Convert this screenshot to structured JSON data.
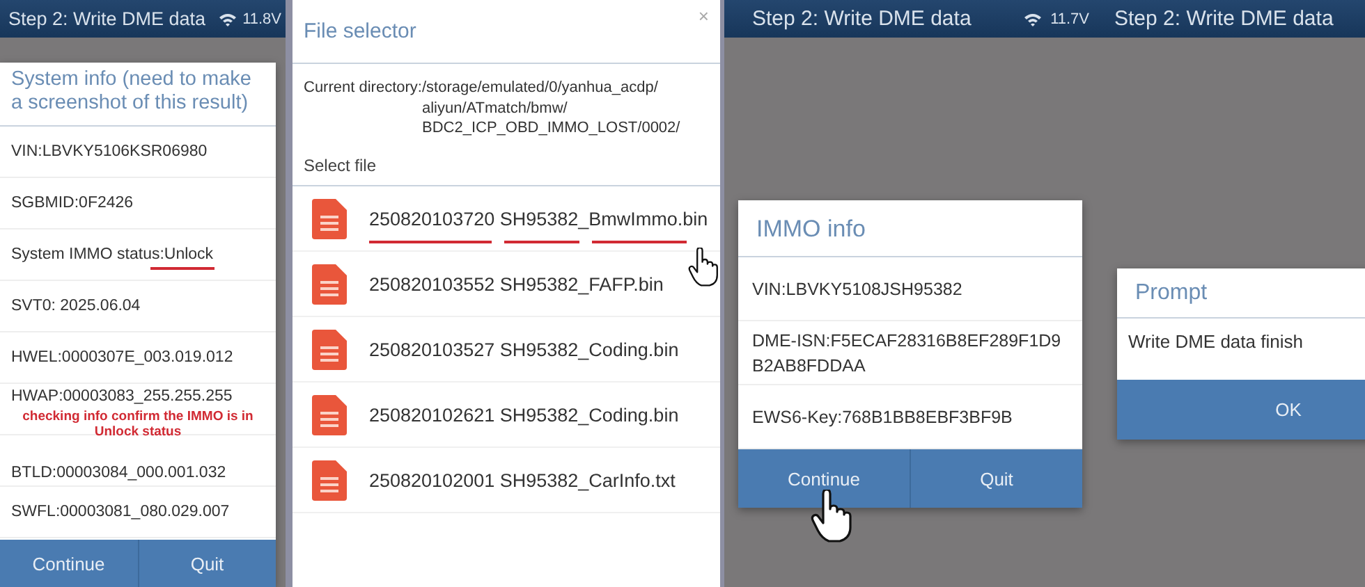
{
  "panels": [
    {
      "kind": "system_info",
      "header": {
        "title": "Step 2: Write DME data",
        "voltage": "11.8V"
      },
      "dialog": {
        "title": "System info (need to make a screenshot of this result)",
        "rows": [
          {
            "text": "VIN:LBVKY5106KSR06980",
            "underlined": false
          },
          {
            "text": "SGBMID:0F2426",
            "underlined": false
          },
          {
            "text": "System IMMO status:Unlock",
            "underlined": true
          },
          {
            "text": "SVT0: 2025.06.04",
            "underlined": false
          },
          {
            "text": "HWEL:0000307E_003.019.012",
            "underlined": false
          },
          {
            "text": "HWAP:00003083_255.255.255",
            "underlined": false,
            "note": "checking info confirm the IMMO is in Unlock status"
          },
          {
            "text": "BTLD:00003084_000.001.032",
            "underlined": false
          },
          {
            "text": "SWFL:00003081_080.029.007",
            "underlined": false
          }
        ],
        "buttons": [
          "Continue",
          "Quit"
        ]
      }
    },
    {
      "kind": "file_selector",
      "dialog": {
        "title": "File selector",
        "close": "×",
        "directory_label": "Current directory:",
        "directory_lines": [
          "/storage/emulated/0/yanhua_acdp/",
          "aliyun/ATmatch/bmw/",
          "BDC2_ICP_OBD_IMMO_LOST/0002/"
        ],
        "section": "Select file",
        "files": [
          {
            "name": "250820103720 SH95382_BmwImmo.bin",
            "underlined": true
          },
          {
            "name": "250820103552 SH95382_FAFP.bin",
            "underlined": false
          },
          {
            "name": "250820103527 SH95382_Coding.bin",
            "underlined": false
          },
          {
            "name": "250820102621 SH95382_Coding.bin",
            "underlined": false
          },
          {
            "name": "250820102001 SH95382_CarInfo.txt",
            "underlined": false
          }
        ]
      }
    },
    {
      "kind": "immo_info",
      "header": {
        "title": "Step 2: Write DME data",
        "voltage": "11.7V"
      },
      "dialog": {
        "title": "IMMO info",
        "rows": [
          {
            "text": "VIN:LBVKY5108JSH95382"
          },
          {
            "text": "DME-ISN:F5ECAF28316B8EF289F1D9B2AB8FDDAA"
          },
          {
            "text": "EWS6-Key:768B1BB8EBF3BF9B"
          }
        ],
        "buttons": [
          "Continue",
          "Quit"
        ]
      }
    },
    {
      "kind": "prompt",
      "header": {
        "title": "Step 2: Write DME data"
      },
      "dialog": {
        "title": "Prompt",
        "message": "Write DME data finish",
        "buttons": [
          "OK"
        ]
      }
    }
  ]
}
